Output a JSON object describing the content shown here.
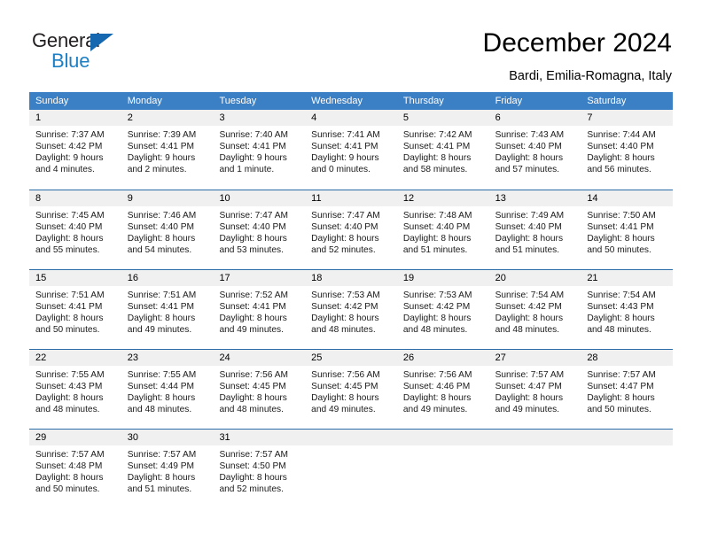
{
  "brand": {
    "name_part1": "General",
    "name_part2": "Blue",
    "accent_color": "#1e7fc4",
    "triangle_color": "#1567b0"
  },
  "header": {
    "title": "December 2024",
    "subtitle": "Bardi, Emilia-Romagna, Italy"
  },
  "calendar": {
    "header_bg": "#3b7fc4",
    "day_band_bg": "#f0f0f0",
    "weekdays": [
      "Sunday",
      "Monday",
      "Tuesday",
      "Wednesday",
      "Thursday",
      "Friday",
      "Saturday"
    ],
    "weeks": [
      [
        {
          "day": "1",
          "sunrise": "Sunrise: 7:37 AM",
          "sunset": "Sunset: 4:42 PM",
          "daylight_line1": "Daylight: 9 hours",
          "daylight_line2": "and 4 minutes."
        },
        {
          "day": "2",
          "sunrise": "Sunrise: 7:39 AM",
          "sunset": "Sunset: 4:41 PM",
          "daylight_line1": "Daylight: 9 hours",
          "daylight_line2": "and 2 minutes."
        },
        {
          "day": "3",
          "sunrise": "Sunrise: 7:40 AM",
          "sunset": "Sunset: 4:41 PM",
          "daylight_line1": "Daylight: 9 hours",
          "daylight_line2": "and 1 minute."
        },
        {
          "day": "4",
          "sunrise": "Sunrise: 7:41 AM",
          "sunset": "Sunset: 4:41 PM",
          "daylight_line1": "Daylight: 9 hours",
          "daylight_line2": "and 0 minutes."
        },
        {
          "day": "5",
          "sunrise": "Sunrise: 7:42 AM",
          "sunset": "Sunset: 4:41 PM",
          "daylight_line1": "Daylight: 8 hours",
          "daylight_line2": "and 58 minutes."
        },
        {
          "day": "6",
          "sunrise": "Sunrise: 7:43 AM",
          "sunset": "Sunset: 4:40 PM",
          "daylight_line1": "Daylight: 8 hours",
          "daylight_line2": "and 57 minutes."
        },
        {
          "day": "7",
          "sunrise": "Sunrise: 7:44 AM",
          "sunset": "Sunset: 4:40 PM",
          "daylight_line1": "Daylight: 8 hours",
          "daylight_line2": "and 56 minutes."
        }
      ],
      [
        {
          "day": "8",
          "sunrise": "Sunrise: 7:45 AM",
          "sunset": "Sunset: 4:40 PM",
          "daylight_line1": "Daylight: 8 hours",
          "daylight_line2": "and 55 minutes."
        },
        {
          "day": "9",
          "sunrise": "Sunrise: 7:46 AM",
          "sunset": "Sunset: 4:40 PM",
          "daylight_line1": "Daylight: 8 hours",
          "daylight_line2": "and 54 minutes."
        },
        {
          "day": "10",
          "sunrise": "Sunrise: 7:47 AM",
          "sunset": "Sunset: 4:40 PM",
          "daylight_line1": "Daylight: 8 hours",
          "daylight_line2": "and 53 minutes."
        },
        {
          "day": "11",
          "sunrise": "Sunrise: 7:47 AM",
          "sunset": "Sunset: 4:40 PM",
          "daylight_line1": "Daylight: 8 hours",
          "daylight_line2": "and 52 minutes."
        },
        {
          "day": "12",
          "sunrise": "Sunrise: 7:48 AM",
          "sunset": "Sunset: 4:40 PM",
          "daylight_line1": "Daylight: 8 hours",
          "daylight_line2": "and 51 minutes."
        },
        {
          "day": "13",
          "sunrise": "Sunrise: 7:49 AM",
          "sunset": "Sunset: 4:40 PM",
          "daylight_line1": "Daylight: 8 hours",
          "daylight_line2": "and 51 minutes."
        },
        {
          "day": "14",
          "sunrise": "Sunrise: 7:50 AM",
          "sunset": "Sunset: 4:41 PM",
          "daylight_line1": "Daylight: 8 hours",
          "daylight_line2": "and 50 minutes."
        }
      ],
      [
        {
          "day": "15",
          "sunrise": "Sunrise: 7:51 AM",
          "sunset": "Sunset: 4:41 PM",
          "daylight_line1": "Daylight: 8 hours",
          "daylight_line2": "and 50 minutes."
        },
        {
          "day": "16",
          "sunrise": "Sunrise: 7:51 AM",
          "sunset": "Sunset: 4:41 PM",
          "daylight_line1": "Daylight: 8 hours",
          "daylight_line2": "and 49 minutes."
        },
        {
          "day": "17",
          "sunrise": "Sunrise: 7:52 AM",
          "sunset": "Sunset: 4:41 PM",
          "daylight_line1": "Daylight: 8 hours",
          "daylight_line2": "and 49 minutes."
        },
        {
          "day": "18",
          "sunrise": "Sunrise: 7:53 AM",
          "sunset": "Sunset: 4:42 PM",
          "daylight_line1": "Daylight: 8 hours",
          "daylight_line2": "and 48 minutes."
        },
        {
          "day": "19",
          "sunrise": "Sunrise: 7:53 AM",
          "sunset": "Sunset: 4:42 PM",
          "daylight_line1": "Daylight: 8 hours",
          "daylight_line2": "and 48 minutes."
        },
        {
          "day": "20",
          "sunrise": "Sunrise: 7:54 AM",
          "sunset": "Sunset: 4:42 PM",
          "daylight_line1": "Daylight: 8 hours",
          "daylight_line2": "and 48 minutes."
        },
        {
          "day": "21",
          "sunrise": "Sunrise: 7:54 AM",
          "sunset": "Sunset: 4:43 PM",
          "daylight_line1": "Daylight: 8 hours",
          "daylight_line2": "and 48 minutes."
        }
      ],
      [
        {
          "day": "22",
          "sunrise": "Sunrise: 7:55 AM",
          "sunset": "Sunset: 4:43 PM",
          "daylight_line1": "Daylight: 8 hours",
          "daylight_line2": "and 48 minutes."
        },
        {
          "day": "23",
          "sunrise": "Sunrise: 7:55 AM",
          "sunset": "Sunset: 4:44 PM",
          "daylight_line1": "Daylight: 8 hours",
          "daylight_line2": "and 48 minutes."
        },
        {
          "day": "24",
          "sunrise": "Sunrise: 7:56 AM",
          "sunset": "Sunset: 4:45 PM",
          "daylight_line1": "Daylight: 8 hours",
          "daylight_line2": "and 48 minutes."
        },
        {
          "day": "25",
          "sunrise": "Sunrise: 7:56 AM",
          "sunset": "Sunset: 4:45 PM",
          "daylight_line1": "Daylight: 8 hours",
          "daylight_line2": "and 49 minutes."
        },
        {
          "day": "26",
          "sunrise": "Sunrise: 7:56 AM",
          "sunset": "Sunset: 4:46 PM",
          "daylight_line1": "Daylight: 8 hours",
          "daylight_line2": "and 49 minutes."
        },
        {
          "day": "27",
          "sunrise": "Sunrise: 7:57 AM",
          "sunset": "Sunset: 4:47 PM",
          "daylight_line1": "Daylight: 8 hours",
          "daylight_line2": "and 49 minutes."
        },
        {
          "day": "28",
          "sunrise": "Sunrise: 7:57 AM",
          "sunset": "Sunset: 4:47 PM",
          "daylight_line1": "Daylight: 8 hours",
          "daylight_line2": "and 50 minutes."
        }
      ],
      [
        {
          "day": "29",
          "sunrise": "Sunrise: 7:57 AM",
          "sunset": "Sunset: 4:48 PM",
          "daylight_line1": "Daylight: 8 hours",
          "daylight_line2": "and 50 minutes."
        },
        {
          "day": "30",
          "sunrise": "Sunrise: 7:57 AM",
          "sunset": "Sunset: 4:49 PM",
          "daylight_line1": "Daylight: 8 hours",
          "daylight_line2": "and 51 minutes."
        },
        {
          "day": "31",
          "sunrise": "Sunrise: 7:57 AM",
          "sunset": "Sunset: 4:50 PM",
          "daylight_line1": "Daylight: 8 hours",
          "daylight_line2": "and 52 minutes."
        },
        {
          "day": "",
          "sunrise": "",
          "sunset": "",
          "daylight_line1": "",
          "daylight_line2": ""
        },
        {
          "day": "",
          "sunrise": "",
          "sunset": "",
          "daylight_line1": "",
          "daylight_line2": ""
        },
        {
          "day": "",
          "sunrise": "",
          "sunset": "",
          "daylight_line1": "",
          "daylight_line2": ""
        },
        {
          "day": "",
          "sunrise": "",
          "sunset": "",
          "daylight_line1": "",
          "daylight_line2": ""
        }
      ]
    ]
  }
}
